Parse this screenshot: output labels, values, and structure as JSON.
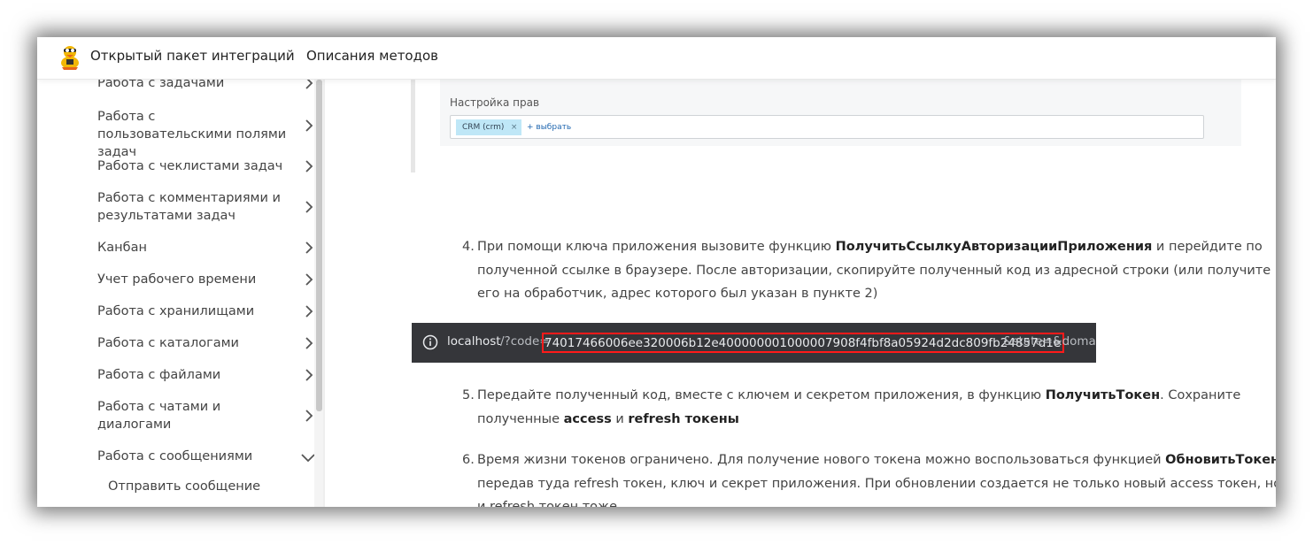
{
  "header": {
    "brand": "Открытый пакет интеграций",
    "nav_link": "Описания методов"
  },
  "sidebar": {
    "items": [
      {
        "label": "Работа с задачами",
        "expanded": false
      },
      {
        "label": "Работа с пользовательскими полями задач",
        "expanded": false
      },
      {
        "label": "Работа с чеклистами задач",
        "expanded": false
      },
      {
        "label": "Работа с комментариями и результатами задач",
        "expanded": false
      },
      {
        "label": "Канбан",
        "expanded": false
      },
      {
        "label": "Учет рабочего времени",
        "expanded": false
      },
      {
        "label": "Работа с хранилищами",
        "expanded": false
      },
      {
        "label": "Работа с каталогами",
        "expanded": false
      },
      {
        "label": "Работа с файлами",
        "expanded": false
      },
      {
        "label": "Работа с чатами и диалогами",
        "expanded": false
      },
      {
        "label": "Работа с сообщениями",
        "expanded": true
      }
    ],
    "subitem": "Отправить сообщение"
  },
  "rights": {
    "label": "Настройка прав",
    "tag": "CRM (crm)",
    "tag_close": "×",
    "pick": "+ выбрать"
  },
  "steps": {
    "s4": {
      "num": "4.",
      "t1": "При помощи ключа приложения вызовите функцию ",
      "b1": "ПолучитьСсылкуАвторизацииПриложения",
      "t2": " и перейдите по полученной ссылке в браузере. После авторизации, скопируйте полученный код из адресной строки (или получите его на обработчик, адрес которого был указан в пункте 2)"
    },
    "s5": {
      "num": "5.",
      "t1": "Передайте полученный код, вместе с ключем и секретом приложения, в функцию ",
      "b1": "ПолучитьТокен",
      "t2": ". Сохраните полученные ",
      "b2": "access",
      "t3": " и ",
      "b3": "refresh токены"
    },
    "s6": {
      "num": "6.",
      "t1": "Время жизни токенов ограничено. Для получение нового токена можно воспользоваться функцией ",
      "b1": "ОбновитьТокен",
      "t2": ", передав туда refresh токен, ключ и секрет приложения. При обновлении создается не только новый access токен, но и refresh токен тоже"
    }
  },
  "url": {
    "host": "localhost",
    "path": "/?code=",
    "code": "74017466006ee320006b12e400000001000007908f4fbf8a05924d2dc809fb24857d1e",
    "tail": "&state=&domain"
  },
  "colors": {
    "highlight_border": "#ff1a1a",
    "urlbar_bg": "#35363a",
    "tag_bg": "#bfe7f7"
  }
}
